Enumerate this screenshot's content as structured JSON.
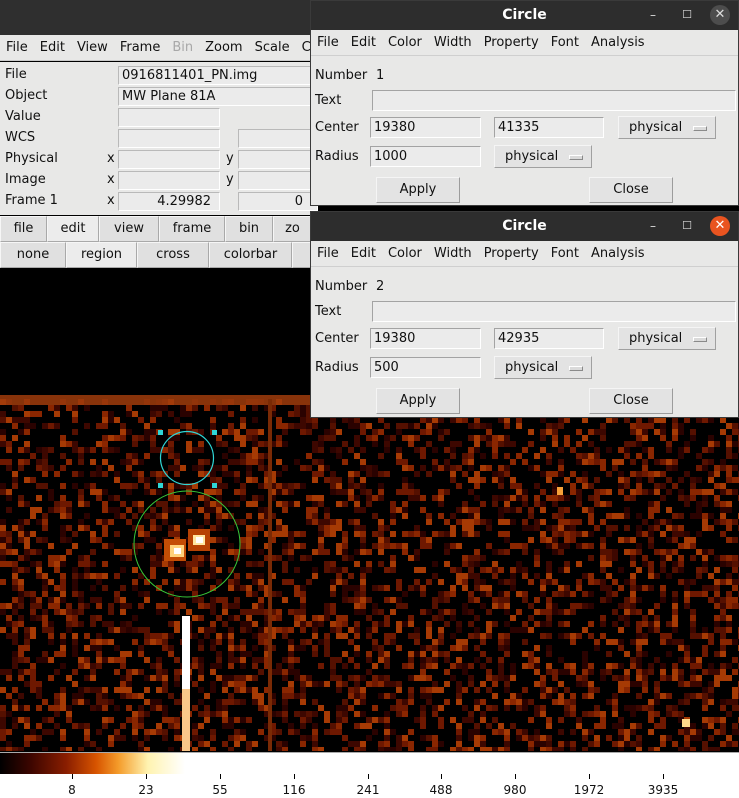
{
  "ds9": {
    "menubar": [
      "File",
      "Edit",
      "View",
      "Frame",
      "Bin",
      "Zoom",
      "Scale",
      "Co"
    ],
    "disabled_menus": [
      "Bin"
    ],
    "info": {
      "file_label": "File",
      "file_value": "0916811401_PN.img",
      "object_label": "Object",
      "object_value": "MW Plane 81A",
      "value_label": "Value",
      "wcs_label": "WCS",
      "physical_label": "Physical",
      "image_label": "Image",
      "frame_label": "Frame 1",
      "x_label": "x",
      "y_label": "y",
      "frame_x_value": "4.29982",
      "frame_y_value": "0"
    },
    "button_row_1": [
      "file",
      "edit",
      "view",
      "frame",
      "bin",
      "zo"
    ],
    "button_row_1_active": "edit",
    "button_row_2": [
      "none",
      "region",
      "cross",
      "colorbar",
      ""
    ],
    "button_row_2_active": "region",
    "colorbar": {
      "colormap": "heat",
      "ticks": [
        "8",
        "23",
        "55",
        "116",
        "241",
        "488",
        "980",
        "1972",
        "3935"
      ]
    },
    "regions": [
      {
        "shape": "circle",
        "color": "#2fd6d6",
        "selected": true
      },
      {
        "shape": "circle",
        "color": "#38c838",
        "selected": false
      }
    ]
  },
  "dialog1": {
    "title": "Circle",
    "menubar": [
      "File",
      "Edit",
      "Color",
      "Width",
      "Property",
      "Font",
      "Analysis"
    ],
    "number_label": "Number",
    "number_value": "1",
    "text_label": "Text",
    "text_value": "",
    "center_label": "Center",
    "center_x": "19380",
    "center_y": "41335",
    "center_system": "physical",
    "radius_label": "Radius",
    "radius_value": "1000",
    "radius_system": "physical",
    "apply_label": "Apply",
    "close_label": "Close",
    "focused": false
  },
  "dialog2": {
    "title": "Circle",
    "menubar": [
      "File",
      "Edit",
      "Color",
      "Width",
      "Property",
      "Font",
      "Analysis"
    ],
    "number_label": "Number",
    "number_value": "2",
    "text_label": "Text",
    "text_value": "",
    "center_label": "Center",
    "center_x": "19380",
    "center_y": "42935",
    "center_system": "physical",
    "radius_label": "Radius",
    "radius_value": "500",
    "radius_system": "physical",
    "apply_label": "Apply",
    "close_label": "Close",
    "focused": true
  },
  "window_controls": {
    "minimize": "–",
    "maximize": "☐",
    "close": "✕"
  }
}
